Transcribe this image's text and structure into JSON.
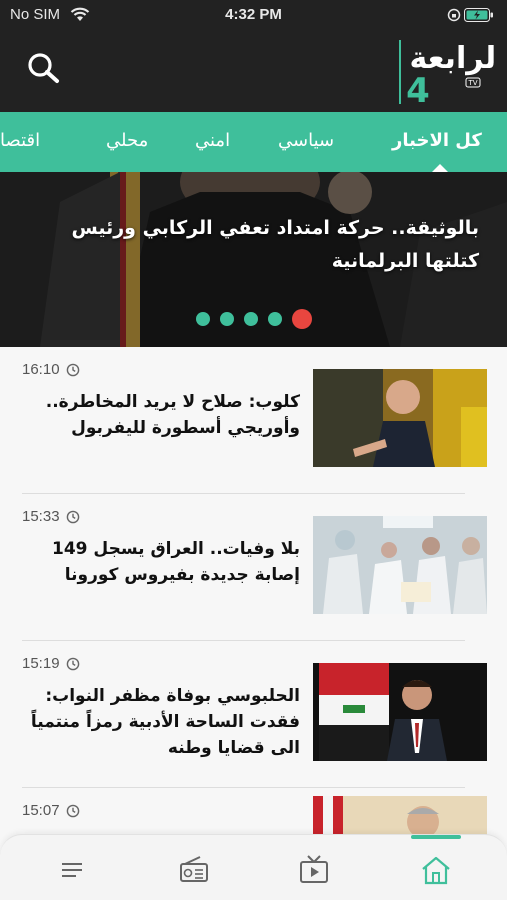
{
  "status_bar": {
    "carrier": "No SIM",
    "time": "4:32 PM"
  },
  "header": {
    "logo_text": "الرابعة",
    "logo_badge": "TV",
    "logo_digit": "4"
  },
  "tabs": [
    {
      "label": "كل الاخبار",
      "active": true
    },
    {
      "label": "سياسي"
    },
    {
      "label": "امني"
    },
    {
      "label": "محلي"
    },
    {
      "label": "اقتصاد"
    }
  ],
  "hero": {
    "title": "بالوثيقة.. حركة امتداد تعفي الركابي ورئيس كتلتها البرلمانية",
    "slide_count": 5,
    "active_slide": 5
  },
  "news": [
    {
      "time": "16:10",
      "title": "كلوب: صلاح لا يريد المخاطرة.. وأوريجي أسطورة لليفربول"
    },
    {
      "time": "15:33",
      "title": "بلا وفيات.. العراق يسجل 149 إصابة جديدة بفيروس كورونا"
    },
    {
      "time": "15:19",
      "title": "الحلبوسي بوفاة مظفر النواب: فقدت الساحة الأدبية رمزاً منتمياً الى قضايا وطنه"
    },
    {
      "time": "15:07",
      "title": ""
    }
  ],
  "bottom_nav": [
    "menu-icon",
    "radio-icon",
    "tv-icon",
    "home-icon"
  ],
  "colors": {
    "accent": "#3fbf9b",
    "dark": "#222222",
    "active_dot": "#e8463f"
  }
}
